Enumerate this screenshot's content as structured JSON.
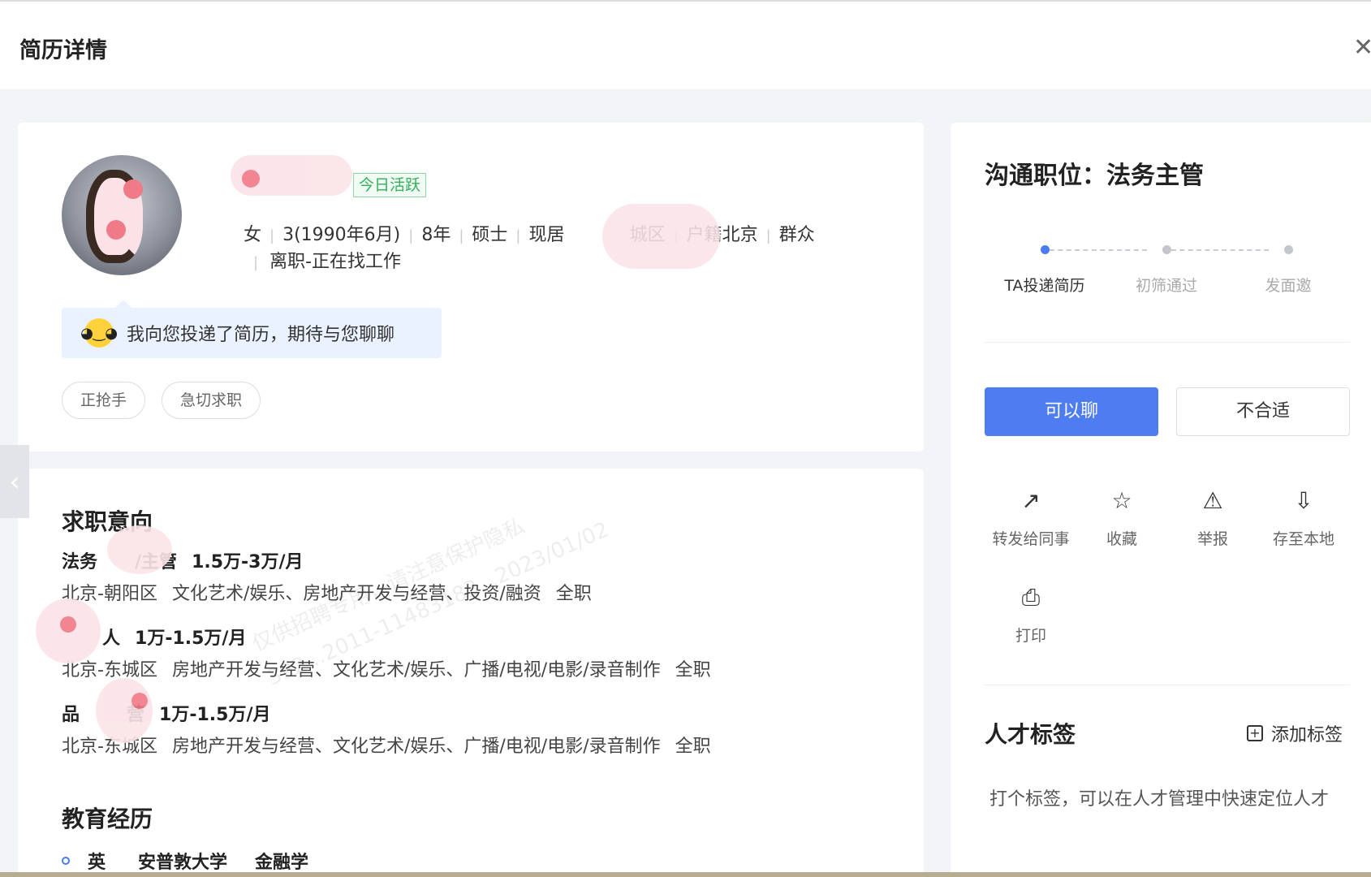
{
  "header": {
    "title": "简历详情"
  },
  "profile": {
    "active_badge": "今日活跃",
    "info": [
      "女",
      "3",
      "(1990年6月)",
      "8年",
      "硕士",
      "现居",
      "城区",
      "户籍北京",
      "群众"
    ],
    "status": "离职-正在找工作",
    "greeting": "我向您投递了简历，期待与您聊聊",
    "tags": [
      "正抢手",
      "急切求职"
    ]
  },
  "intent": {
    "title": "求职意向",
    "jobs": [
      {
        "title": "法务",
        "title_suffix": "/主管",
        "salary": "1.5万-3万/月",
        "location": "北京-朝阳区",
        "industries": "文化艺术/娱乐、房地产开发与经营、投资/融资",
        "type": "全职"
      },
      {
        "title": "",
        "title_suffix": "人",
        "salary": "1万-1.5万/月",
        "location": "北京-东城区",
        "industries": "房地产开发与经营、文化艺术/娱乐、广播/电视/电影/录音制作",
        "type": "全职"
      },
      {
        "title": "品",
        "title_suffix": "营",
        "salary": "1万-1.5万/月",
        "location": "北京-东城区",
        "industries": "房地产开发与经营、文化艺术/娱乐、广播/电视/电影/录音制作",
        "type": "全职"
      }
    ]
  },
  "education": {
    "title": "教育经历",
    "items": [
      {
        "school_prefix": "英",
        "school": "安普敦大学",
        "major": "金融学"
      }
    ]
  },
  "watermark": [
    "仅供招聘专用，请注意保护隐私",
    "392...2011-11483183...2023/01/02"
  ],
  "side": {
    "position_title": "沟通职位：法务主管",
    "steps": [
      "TA投递简历",
      "初筛通过",
      "发面邀"
    ],
    "btn_chat": "可以聊",
    "btn_reject": "不合适",
    "actions": [
      {
        "label": "转发给同事",
        "icon": "share-icon",
        "glyph": "↗"
      },
      {
        "label": "收藏",
        "icon": "star-icon",
        "glyph": "☆"
      },
      {
        "label": "举报",
        "icon": "warning-icon",
        "glyph": "⚠"
      },
      {
        "label": "存至本地",
        "icon": "download-icon",
        "glyph": "⇩"
      },
      {
        "label": "打印",
        "icon": "print-icon",
        "glyph": "⎙"
      }
    ],
    "talent_title": "人才标签",
    "add_tag": "添加标签",
    "talent_hint": "打个标签，可以在人才管理中快速定位人才"
  }
}
